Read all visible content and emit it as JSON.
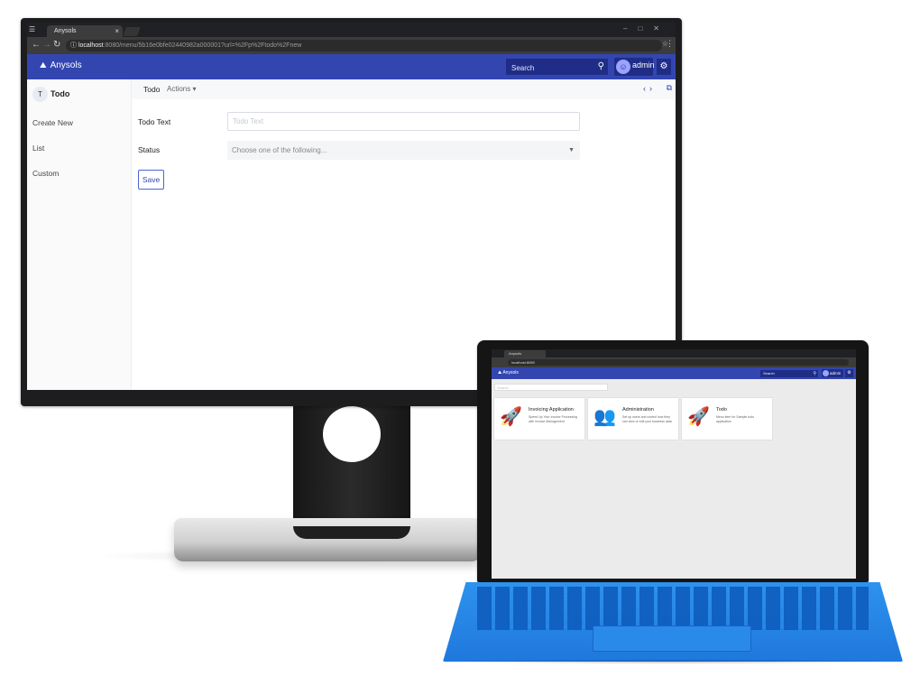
{
  "monitor": {
    "browser": {
      "tab_title": "Anysols",
      "tab_close": "×",
      "url_host": "localhost",
      "url_path": ":8080/menu/5b16e0bfe02440982a000001?url=%2Fp%2Ftodo%2Fnew"
    },
    "header": {
      "brand": "Anysols",
      "search_placeholder": "Search",
      "user_name": "admin"
    },
    "sidebar": {
      "avatar_letter": "T",
      "title": "Todo",
      "items": [
        {
          "label": "Create New"
        },
        {
          "label": "List"
        },
        {
          "label": "Custom"
        }
      ]
    },
    "toolbar": {
      "breadcrumb": "Todo",
      "actions_label": "Actions"
    },
    "form": {
      "todo_text_label": "Todo Text",
      "todo_text_placeholder": "Todo Text",
      "status_label": "Status",
      "status_placeholder": "Choose one of the following...",
      "save_label": "Save"
    }
  },
  "laptop": {
    "browser": {
      "tab_title": "Anysols",
      "url": "localhost:8080"
    },
    "header": {
      "brand": "Anysols",
      "search_placeholder": "Search",
      "user_name": "admin"
    },
    "filter_placeholder": "Search",
    "cards": [
      {
        "title": "Invoicing Application",
        "description": "Speed Up Your Invoice Processing with Invoice Management",
        "icon": "rocket-icon"
      },
      {
        "title": "Administration",
        "description": "Set up users and control how they can view or edit your business data",
        "icon": "users-icon"
      },
      {
        "title": "Todo",
        "description": "Menu item for Sample todo application",
        "icon": "rocket-icon"
      }
    ]
  },
  "colors": {
    "header_bg": "#3346b0",
    "header_dark": "#1f2d86",
    "keyboard_blue": "#1f78dc"
  }
}
